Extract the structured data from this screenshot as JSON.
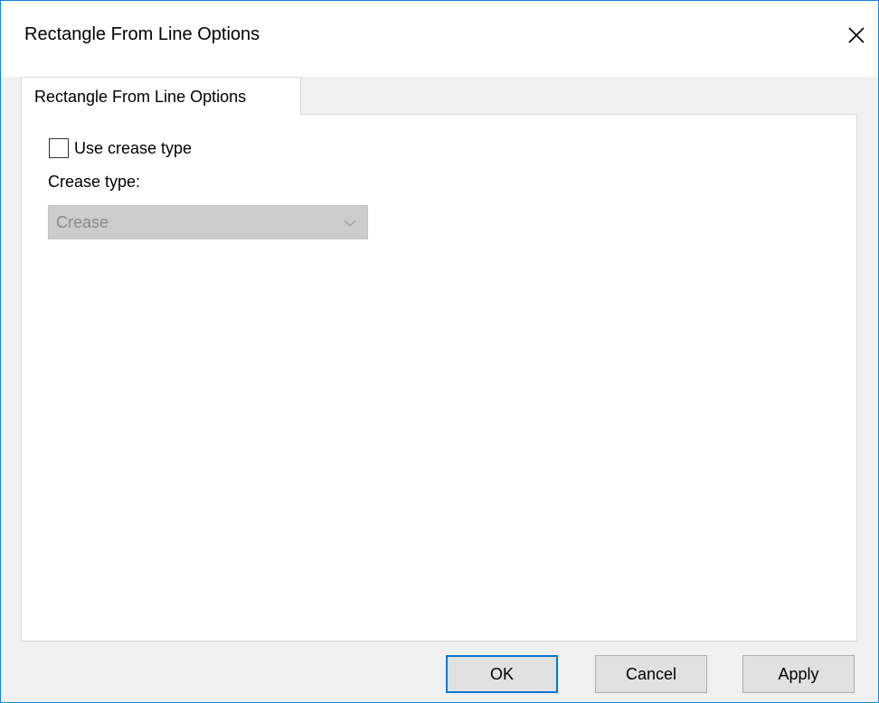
{
  "window": {
    "title": "Rectangle From Line Options",
    "close_icon": "close-icon"
  },
  "tabs": [
    {
      "label": "Rectangle From Line Options",
      "selected": true
    }
  ],
  "options": {
    "use_crease_type": {
      "label": "Use crease type",
      "checked": false
    },
    "crease_type": {
      "label": "Crease type:",
      "value": "Crease",
      "enabled": false
    }
  },
  "buttons": {
    "ok": "OK",
    "cancel": "Cancel",
    "apply": "Apply"
  },
  "colors": {
    "accent": "#0078d7",
    "window_border": "#1883d7",
    "dialog_bg": "#f0f0f0",
    "panel_bg": "#ffffff",
    "disabled_field_bg": "#cccccc",
    "disabled_text": "#8a8a8a"
  }
}
